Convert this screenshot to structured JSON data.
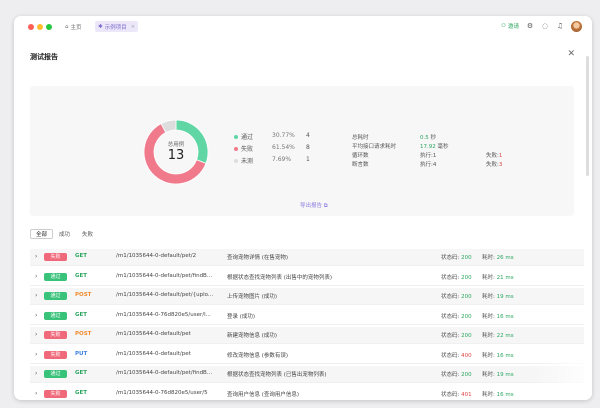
{
  "tabs": [
    {
      "label": "主页"
    },
    {
      "label": "示例项目"
    }
  ],
  "toolbar": {
    "invite_label": "邀请"
  },
  "panel": {
    "title": "测试报告"
  },
  "summary": {
    "total_label": "总用例",
    "total": "13",
    "legend": [
      {
        "name": "通过",
        "percent": "30.77%",
        "count": "4",
        "color": "#5fd6a4"
      },
      {
        "name": "失败",
        "percent": "61.54%",
        "count": "8",
        "color": "#f07a8c"
      },
      {
        "name": "未测",
        "percent": "7.69%",
        "count": "1",
        "color": "#dddddd"
      }
    ],
    "stats": {
      "total_time_label": "总耗时",
      "total_time_value": "0.5",
      "total_time_unit": "秒",
      "avg_label": "平均接口请求耗时",
      "avg_value": "17.92",
      "avg_unit": "毫秒",
      "loop_label": "循环数",
      "loop_exec": "执行:1",
      "loop_fail_label": "失败:",
      "loop_fail_value": "1",
      "assert_label": "断言数",
      "assert_exec": "执行:4",
      "assert_fail_label": "失败:",
      "assert_fail_value": "3"
    },
    "export_label": "导出报告"
  },
  "chart_data": {
    "type": "pie",
    "title": "",
    "categories": [
      "通过",
      "失败",
      "未测"
    ],
    "values": [
      4,
      8,
      1
    ],
    "colors": [
      "#5fd6a4",
      "#f07a8c",
      "#dddddd"
    ]
  },
  "filters": [
    {
      "label": "全部",
      "active": true
    },
    {
      "label": "成功",
      "active": false
    },
    {
      "label": "失败",
      "active": false
    }
  ],
  "rows": [
    {
      "result": "失败",
      "method": "GET",
      "path": "/m1/1035644-0-default/pet/2",
      "desc": "查询宠物详情 (在售宠物)",
      "status_label": "状态码:",
      "status": "200",
      "time_label": "耗时:",
      "time": "26 ms"
    },
    {
      "result": "通过",
      "method": "GET",
      "path": "/m1/1035644-0-default/pet/findB...",
      "desc": "根据状态查找宠物列表 (出售中的宠物列表)",
      "status_label": "状态码:",
      "status": "200",
      "time_label": "耗时:",
      "time": "21 ms"
    },
    {
      "result": "通过",
      "method": "POST",
      "path": "/m1/1035644-0-default/pet/{uplo...",
      "desc": "上传宠物图片 (成功)",
      "status_label": "状态码:",
      "status": "200",
      "time_label": "耗时:",
      "time": "19 ms"
    },
    {
      "result": "通过",
      "method": "GET",
      "path": "/m1/1035644-0-76d820e5/user/l...",
      "desc": "登录 (成功)",
      "status_label": "状态码:",
      "status": "200",
      "time_label": "耗时:",
      "time": "16 ms"
    },
    {
      "result": "失败",
      "method": "POST",
      "path": "/m1/1035644-0-default/pet",
      "desc": "新建宠物信息 (成功)",
      "status_label": "状态码:",
      "status": "200",
      "time_label": "耗时:",
      "time": "22 ms"
    },
    {
      "result": "失败",
      "method": "PUT",
      "path": "/m1/1035644-0-default/pet",
      "desc": "修改宠物信息 (参数有误)",
      "status_label": "状态码:",
      "status": "400",
      "time_label": "耗时:",
      "time": "16 ms"
    },
    {
      "result": "通过",
      "method": "GET",
      "path": "/m1/1035644-0-default/pet/findB...",
      "desc": "根据状态查找宠物列表 (已售出宠物列表)",
      "status_label": "状态码:",
      "status": "200",
      "time_label": "耗时:",
      "time": "19 ms"
    },
    {
      "result": "失败",
      "method": "GET",
      "path": "/m1/1035644-0-76d820e5/user/5",
      "desc": "查询用户信息 (查询用户信息)",
      "status_label": "状态码:",
      "status": "401",
      "time_label": "耗时:",
      "time": "16 ms"
    }
  ]
}
